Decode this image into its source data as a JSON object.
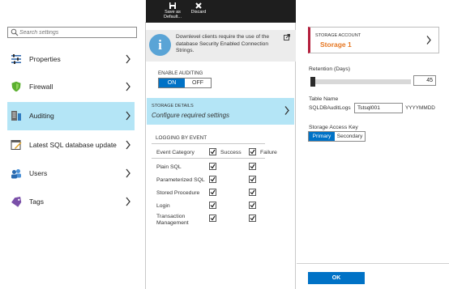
{
  "left_blade": {
    "search": {
      "placeholder": "Search settings",
      "value": ""
    },
    "items": [
      {
        "label": "Properties",
        "icon": "properties-icon"
      },
      {
        "label": "Firewall",
        "icon": "firewall-shield-icon"
      },
      {
        "label": "Auditing",
        "icon": "auditing-icon",
        "active": true
      },
      {
        "label": "Latest SQL database update",
        "icon": "database-update-icon"
      },
      {
        "label": "Users",
        "icon": "users-icon"
      },
      {
        "label": "Tags",
        "icon": "tag-icon"
      }
    ]
  },
  "middle_blade": {
    "commands": [
      {
        "label_line1": "Save as",
        "label_line2": "Default...",
        "icon": "save-icon"
      },
      {
        "label_line1": "Discard",
        "label_line2": "",
        "icon": "discard-x-icon"
      }
    ],
    "info_text": "Downlevel clients require the use of the database Security Enabled Connection Strings.",
    "enable_auditing": {
      "label": "ENABLE AUDITING",
      "on": "ON",
      "off": "OFF",
      "selected": "ON"
    },
    "storage_details": {
      "title": "STORAGE DETAILS",
      "subtitle": "Configure required settings"
    },
    "logging": {
      "title": "LOGGING BY EVENT",
      "header": {
        "category": "Event Category",
        "success": "Success",
        "failure": "Failure"
      },
      "events": [
        {
          "name": "Plain SQL",
          "success": true,
          "failure": true
        },
        {
          "name": "Parameterized SQL",
          "success": true,
          "failure": true
        },
        {
          "name": "Stored Procedure",
          "success": true,
          "failure": true
        },
        {
          "name": "Login",
          "success": true,
          "failure": true
        },
        {
          "name": "Transaction Management",
          "success": true,
          "failure": true
        }
      ]
    }
  },
  "right_blade": {
    "storage_account": {
      "label": "STORAGE ACCOUNT",
      "value": "Storage 1"
    },
    "retention": {
      "label": "Retention (Days)",
      "value": "45",
      "slider_fraction": 0.0
    },
    "table_name": {
      "label": "Table Name",
      "prefix": "SQLDBAuditLogs",
      "value": "Tstsql001",
      "suffix": "YYYYMMDD"
    },
    "access_key": {
      "label": "Storage Access Key",
      "primary": "Primary",
      "secondary": "Secondary",
      "selected": "Primary"
    },
    "ok_label": "OK"
  },
  "colors": {
    "accent": "#0072c6",
    "selected_row": "#b4e5f6",
    "command_bar": "#1e1e1e",
    "storage_name": "#e67722",
    "card_accent": "#b41e3c"
  }
}
